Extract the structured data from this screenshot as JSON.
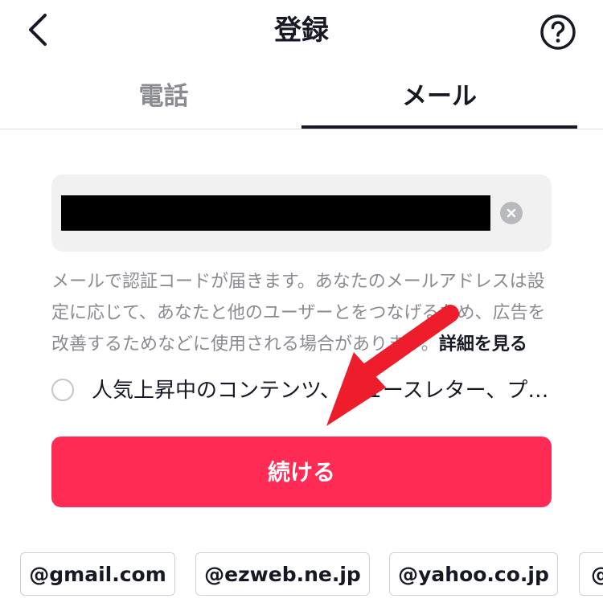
{
  "header": {
    "title": "登録",
    "back_icon": "chevron-left-icon",
    "help_icon": "help-circle-icon"
  },
  "tabs": [
    {
      "label": "電話",
      "active": false
    },
    {
      "label": "メール",
      "active": true
    }
  ],
  "email_input": {
    "value": "",
    "redacted": true
  },
  "notice": {
    "text": "メールで認証コードが届きます。あなたのメールアドレスは設定に応じて、あなたと他のユーザーとをつなげるため、広告を改善するためなどに使用される場合があります。",
    "link": "詳細を見る"
  },
  "consent": {
    "label": "人気上昇中のコンテンツ、ニュースレター、プロモーション、おすすめ情報を受け取る",
    "checked": false
  },
  "continue_button": {
    "label": "続ける"
  },
  "domain_chips": [
    "@gmail.com",
    "@ezweb.ne.jp",
    "@yahoo.co.jp",
    "@"
  ],
  "colors": {
    "accent": "#fe2c55",
    "text_primary": "#161823",
    "text_secondary": "#8a8b91",
    "input_bg": "#f1f1f2",
    "annotation_arrow": "#ee1d2c"
  }
}
